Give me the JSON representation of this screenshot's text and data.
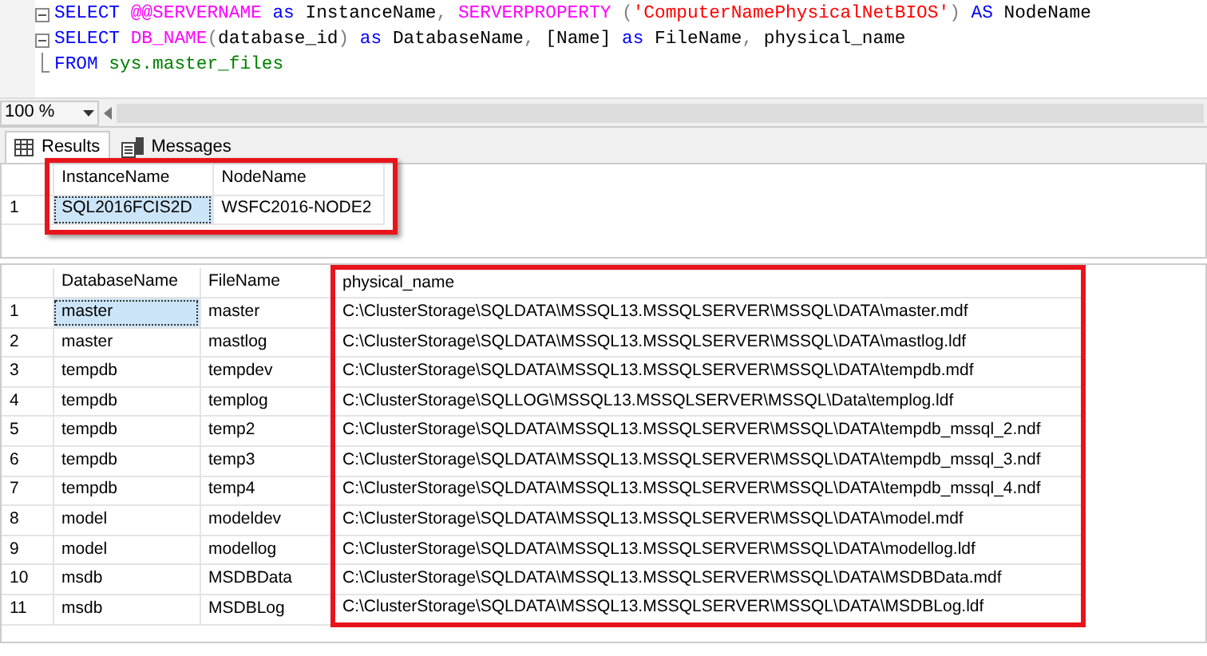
{
  "editor": {
    "lines": [
      {
        "fold": true,
        "tokens": [
          {
            "kind": "keyword",
            "text": "SELECT"
          },
          {
            "kind": "function",
            "text": " @@SERVERNAME"
          },
          {
            "kind": "keyword",
            "text": " as"
          },
          {
            "kind": "text",
            "text": " InstanceName"
          },
          {
            "kind": "punct",
            "text": ", "
          },
          {
            "kind": "function",
            "text": "SERVERPROPERTY"
          },
          {
            "kind": "punct",
            "text": " ("
          },
          {
            "kind": "string",
            "text": "'ComputerNamePhysicalNetBIOS'"
          },
          {
            "kind": "punct",
            "text": ")"
          },
          {
            "kind": "keyword",
            "text": " AS"
          },
          {
            "kind": "text",
            "text": " NodeName"
          }
        ]
      },
      {
        "fold": true,
        "tokens": [
          {
            "kind": "keyword",
            "text": "SELECT"
          },
          {
            "kind": "function",
            "text": " DB_NAME"
          },
          {
            "kind": "punct",
            "text": "("
          },
          {
            "kind": "text",
            "text": "database_id"
          },
          {
            "kind": "punct",
            "text": ")"
          },
          {
            "kind": "keyword",
            "text": " as"
          },
          {
            "kind": "text",
            "text": " DatabaseName"
          },
          {
            "kind": "punct",
            "text": ", "
          },
          {
            "kind": "text",
            "text": "[Name] "
          },
          {
            "kind": "keyword",
            "text": "as"
          },
          {
            "kind": "text",
            "text": " FileName"
          },
          {
            "kind": "punct",
            "text": ", "
          },
          {
            "kind": "text",
            "text": "physical_name"
          }
        ]
      },
      {
        "fold": false,
        "tokens": [
          {
            "kind": "keyword",
            "text": "FROM"
          },
          {
            "kind": "object",
            "text": " sys.master_files"
          }
        ]
      }
    ]
  },
  "zoom": {
    "value": "100 %"
  },
  "tabs": [
    {
      "label": "Results",
      "selected": true
    },
    {
      "label": "Messages",
      "selected": false
    }
  ],
  "grids": [
    {
      "highlighted": true,
      "columns": [
        {
          "label": "InstanceName",
          "highlighted": false
        },
        {
          "label": "NodeName",
          "highlighted": false
        }
      ],
      "rows": [
        {
          "number": "1",
          "cells": [
            {
              "text": "SQL2016FCIS2D",
              "selected": true
            },
            {
              "text": "WSFC2016-NODE2",
              "selected": false
            }
          ]
        }
      ]
    },
    {
      "highlighted": false,
      "columns": [
        {
          "label": "DatabaseName",
          "highlighted": false
        },
        {
          "label": "FileName",
          "highlighted": false
        },
        {
          "label": "physical_name",
          "highlighted": true
        }
      ],
      "rows": [
        {
          "number": "1",
          "cells": [
            {
              "text": "master",
              "selected": true
            },
            {
              "text": "master",
              "selected": false
            },
            {
              "text": "C:\\ClusterStorage\\SQLDATA\\MSSQL13.MSSQLSERVER\\MSSQL\\DATA\\master.mdf",
              "selected": false
            }
          ]
        },
        {
          "number": "2",
          "cells": [
            {
              "text": "master",
              "selected": false
            },
            {
              "text": "mastlog",
              "selected": false
            },
            {
              "text": "C:\\ClusterStorage\\SQLDATA\\MSSQL13.MSSQLSERVER\\MSSQL\\DATA\\mastlog.ldf",
              "selected": false
            }
          ]
        },
        {
          "number": "3",
          "cells": [
            {
              "text": "tempdb",
              "selected": false
            },
            {
              "text": "tempdev",
              "selected": false
            },
            {
              "text": "C:\\ClusterStorage\\SQLDATA\\MSSQL13.MSSQLSERVER\\MSSQL\\DATA\\tempdb.mdf",
              "selected": false
            }
          ]
        },
        {
          "number": "4",
          "cells": [
            {
              "text": "tempdb",
              "selected": false
            },
            {
              "text": "templog",
              "selected": false
            },
            {
              "text": "C:\\ClusterStorage\\SQLLOG\\MSSQL13.MSSQLSERVER\\MSSQL\\Data\\templog.ldf",
              "selected": false
            }
          ]
        },
        {
          "number": "5",
          "cells": [
            {
              "text": "tempdb",
              "selected": false
            },
            {
              "text": "temp2",
              "selected": false
            },
            {
              "text": "C:\\ClusterStorage\\SQLDATA\\MSSQL13.MSSQLSERVER\\MSSQL\\DATA\\tempdb_mssql_2.ndf",
              "selected": false
            }
          ]
        },
        {
          "number": "6",
          "cells": [
            {
              "text": "tempdb",
              "selected": false
            },
            {
              "text": "temp3",
              "selected": false
            },
            {
              "text": "C:\\ClusterStorage\\SQLDATA\\MSSQL13.MSSQLSERVER\\MSSQL\\DATA\\tempdb_mssql_3.ndf",
              "selected": false
            }
          ]
        },
        {
          "number": "7",
          "cells": [
            {
              "text": "tempdb",
              "selected": false
            },
            {
              "text": "temp4",
              "selected": false
            },
            {
              "text": "C:\\ClusterStorage\\SQLDATA\\MSSQL13.MSSQLSERVER\\MSSQL\\DATA\\tempdb_mssql_4.ndf",
              "selected": false
            }
          ]
        },
        {
          "number": "8",
          "cells": [
            {
              "text": "model",
              "selected": false
            },
            {
              "text": "modeldev",
              "selected": false
            },
            {
              "text": "C:\\ClusterStorage\\SQLDATA\\MSSQL13.MSSQLSERVER\\MSSQL\\DATA\\model.mdf",
              "selected": false
            }
          ]
        },
        {
          "number": "9",
          "cells": [
            {
              "text": "model",
              "selected": false
            },
            {
              "text": "modellog",
              "selected": false
            },
            {
              "text": "C:\\ClusterStorage\\SQLDATA\\MSSQL13.MSSQLSERVER\\MSSQL\\DATA\\modellog.ldf",
              "selected": false
            }
          ]
        },
        {
          "number": "10",
          "cells": [
            {
              "text": "msdb",
              "selected": false
            },
            {
              "text": "MSDBData",
              "selected": false
            },
            {
              "text": "C:\\ClusterStorage\\SQLDATA\\MSSQL13.MSSQLSERVER\\MSSQL\\DATA\\MSDBData.mdf",
              "selected": false
            }
          ]
        },
        {
          "number": "11",
          "cells": [
            {
              "text": "msdb",
              "selected": false
            },
            {
              "text": "MSDBLog",
              "selected": false
            },
            {
              "text": "C:\\ClusterStorage\\SQLDATA\\MSSQL13.MSSQLSERVER\\MSSQL\\DATA\\MSDBLog.ldf",
              "selected": false
            }
          ]
        }
      ]
    }
  ]
}
